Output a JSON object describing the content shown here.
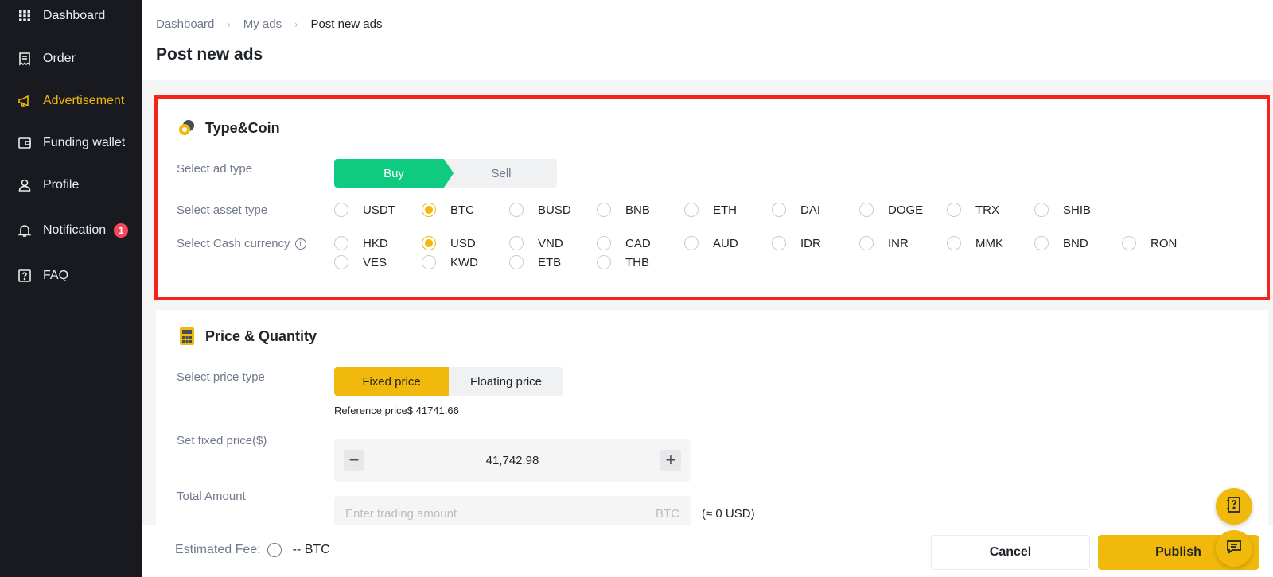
{
  "sidebar": {
    "items": [
      {
        "label": "Dashboard",
        "icon": "grid-icon"
      },
      {
        "label": "Order",
        "icon": "receipt-icon"
      },
      {
        "label": "Advertisement",
        "icon": "megaphone-icon"
      },
      {
        "label": "Funding wallet",
        "icon": "wallet-icon"
      },
      {
        "label": "Profile",
        "icon": "user-icon"
      },
      {
        "label": "Notification",
        "icon": "bell-icon",
        "badge": "1"
      },
      {
        "label": "FAQ",
        "icon": "question-icon"
      }
    ],
    "active_index": 2
  },
  "header": {
    "breadcrumb": [
      "Dashboard",
      "My ads",
      "Post new ads"
    ],
    "title": "Post new ads"
  },
  "type_coin": {
    "title": "Type&Coin",
    "ad_type_label": "Select ad type",
    "buy_label": "Buy",
    "sell_label": "Sell",
    "selected_ad_type": "Buy",
    "asset_label": "Select asset type",
    "assets": [
      "USDT",
      "BTC",
      "BUSD",
      "BNB",
      "ETH",
      "DAI",
      "DOGE",
      "TRX",
      "SHIB"
    ],
    "selected_asset": "BTC",
    "currency_label": "Select Cash currency",
    "currencies": [
      "HKD",
      "USD",
      "VND",
      "CAD",
      "AUD",
      "IDR",
      "INR",
      "MMK",
      "BND",
      "RON",
      "VES",
      "KWD",
      "ETB",
      "THB"
    ],
    "selected_currency": "USD"
  },
  "price_quantity": {
    "title": "Price & Quantity",
    "price_type_label": "Select price type",
    "fixed_label": "Fixed price",
    "floating_label": "Floating price",
    "selected_price_type": "Fixed price",
    "reference_price": "Reference price$ 41741.66",
    "fixed_price_label": "Set fixed price($)",
    "fixed_price_value": "41,742.98",
    "total_amount_label": "Total Amount",
    "amount_placeholder": "Enter trading amount",
    "amount_unit": "BTC",
    "amount_approx": "(≈ 0 USD)"
  },
  "footer": {
    "fee_label": "Estimated Fee:",
    "fee_value": "-- BTC",
    "cancel_label": "Cancel",
    "publish_label": "Publish"
  },
  "colors": {
    "accent": "#f0b90b",
    "buy": "#0ecb81",
    "sidebar_bg": "#181a20",
    "highlight_border": "#f3251b"
  }
}
